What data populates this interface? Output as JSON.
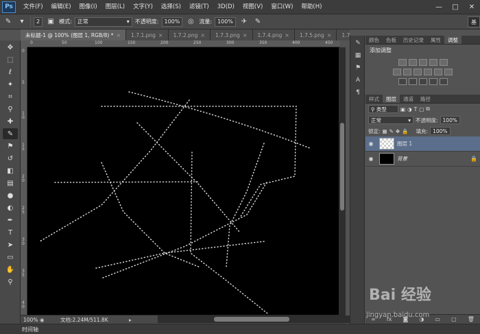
{
  "app": {
    "logo": "Ps"
  },
  "menu": [
    "文件(F)",
    "编辑(E)",
    "图像(I)",
    "图层(L)",
    "文字(Y)",
    "选择(S)",
    "滤镜(T)",
    "3D(D)",
    "视图(V)",
    "窗口(W)",
    "帮助(H)"
  ],
  "window_controls": [
    "—",
    "□",
    "✕"
  ],
  "options": {
    "brush_size": "2",
    "mode_label": "模式:",
    "mode_value": "正常",
    "opacity_label": "不透明度:",
    "opacity_value": "100%",
    "flow_label": "流量:",
    "flow_value": "100%",
    "workspace_label": "基"
  },
  "tabs": [
    {
      "label": "未标题-1 @ 100% (图层 1, RGB/8) *",
      "active": true
    },
    {
      "label": "1.7.1.png"
    },
    {
      "label": "1.7.2.png"
    },
    {
      "label": "1.7.3.png"
    },
    {
      "label": "1.7.4.png"
    },
    {
      "label": "1.7.5.png"
    },
    {
      "label": "1.7.6.p"
    }
  ],
  "ruler_h": [
    "0",
    "50",
    "100",
    "150",
    "200",
    "250",
    "300",
    "350",
    "400",
    "450"
  ],
  "ruler_v": [
    "0",
    "5",
    "1\n0",
    "1\n5",
    "2\n0",
    "2\n5",
    "3\n0",
    "3\n5",
    "4\n0"
  ],
  "status": {
    "zoom": "100%",
    "doc_info": "文档:2.24M/511.8K"
  },
  "timeline_label": "时间轴",
  "adjust_panel": {
    "tabs": [
      "颜色",
      "色板",
      "历史记录",
      "属性",
      "调整"
    ],
    "active_tab": "调整",
    "title": "添加调整"
  },
  "layers_panel": {
    "tabs": [
      "样式",
      "图层",
      "通道",
      "路径"
    ],
    "active_tab": "图层",
    "filter_label": "类型",
    "blend_mode": "正常",
    "opacity_label": "不透明度:",
    "opacity_value": "100%",
    "lock_label": "锁定:",
    "fill_label": "填充:",
    "fill_value": "100%",
    "layers": [
      {
        "name": "图层 1",
        "thumb": "checker",
        "selected": true
      },
      {
        "name": "背景",
        "thumb": "black",
        "locked": true
      }
    ],
    "footer_icons": [
      "link-icon",
      "fx-icon",
      "mask-icon",
      "adjustment-icon",
      "folder-icon",
      "new-layer-icon",
      "trash-icon"
    ]
  },
  "watermark": {
    "logo": "Bai 经验",
    "url": "jingyan.baidu.com"
  }
}
